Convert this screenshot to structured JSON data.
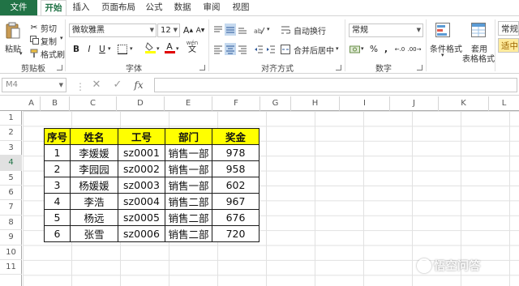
{
  "ribbon_tabs": [
    "文件",
    "开始",
    "插入",
    "页面布局",
    "公式",
    "数据",
    "审阅",
    "视图"
  ],
  "clipboard": {
    "paste": "粘贴",
    "cut": "剪切",
    "copy": "复制",
    "format_painter": "格式刷",
    "group": "剪贴板"
  },
  "font": {
    "name": "微软雅黑",
    "size": "12",
    "grow": "A",
    "shrink": "A",
    "bold": "B",
    "italic": "I",
    "underline": "U",
    "font_color_label": "A",
    "phonetic": "wén",
    "group": "字体"
  },
  "alignment": {
    "wrap_text": "自动换行",
    "merge_center": "合并后居中",
    "group": "对齐方式"
  },
  "number": {
    "format": "常规",
    "percent": "%",
    "comma": ",",
    "group": "数字"
  },
  "styles": {
    "conditional": "条件格式",
    "table_format_1": "套用",
    "table_format_2": "表格格式",
    "cell_style_1": "常规",
    "cell_style_2": "适中"
  },
  "formula_bar": {
    "name_box": "M4",
    "cancel": "✕",
    "enter": "✓",
    "fx": "fx",
    "content": ""
  },
  "columns": [
    "A",
    "B",
    "C",
    "D",
    "E",
    "F",
    "G",
    "H",
    "I",
    "J",
    "K",
    "L"
  ],
  "rows": [
    "1",
    "2",
    "3",
    "4",
    "5",
    "6",
    "7",
    "8",
    "9",
    "10",
    "11"
  ],
  "selected_row": "4",
  "table": {
    "headers": [
      "序号",
      "姓名",
      "工号",
      "部门",
      "奖金"
    ],
    "rows": [
      [
        "1",
        "李媛媛",
        "sz0001",
        "销售一部",
        "978"
      ],
      [
        "2",
        "李园园",
        "sz0002",
        "销售一部",
        "958"
      ],
      [
        "3",
        "杨媛媛",
        "sz0003",
        "销售一部",
        "602"
      ],
      [
        "4",
        "李浩",
        "sz0004",
        "销售二部",
        "967"
      ],
      [
        "5",
        "杨远",
        "sz0005",
        "销售二部",
        "676"
      ],
      [
        "6",
        "张雪",
        "sz0006",
        "销售二部",
        "720"
      ]
    ]
  },
  "watermark": "悟空问答",
  "colors": {
    "excel_green": "#217346",
    "header_fill": "#ffff00",
    "font_red": "#e00000",
    "fill_yellow": "#ffff00"
  }
}
